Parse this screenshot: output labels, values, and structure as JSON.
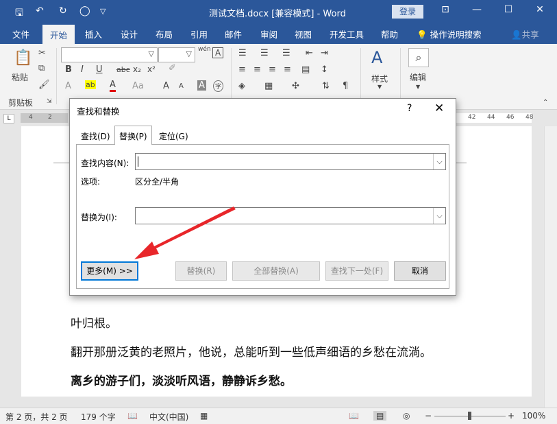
{
  "titlebar": {
    "doc_title": "测试文档.docx [兼容模式] - Word",
    "login_label": "登录",
    "qa_save": "🖫",
    "qa_undo": "↶",
    "qa_redo": "↻",
    "qa_circle": "◯",
    "qa_custom": "▽",
    "ribbon_display": "⊡",
    "minimize": "—",
    "maximize": "☐",
    "close": "✕"
  },
  "ribbon_tabs": [
    "文件",
    "开始",
    "插入",
    "设计",
    "布局",
    "引用",
    "邮件",
    "审阅",
    "视图",
    "开发工具",
    "帮助"
  ],
  "ribbon_search": "操作说明搜索",
  "ribbon_share": "共享",
  "ribbon": {
    "paste_label": "粘贴",
    "clipboard_label": "剪贴板",
    "styles_label": "样式",
    "editing_label": "编辑",
    "wen_label": "wén",
    "font_buttons": [
      "B",
      "I",
      "U",
      "abc",
      "x₂",
      "x²"
    ],
    "font_row3": [
      "A",
      "ab",
      "A",
      "Aa",
      "A",
      "A",
      "A",
      "字"
    ]
  },
  "ruler": {
    "left_nums": [
      "4",
      "2"
    ],
    "right_nums": [
      "42",
      "44",
      "46",
      "48"
    ],
    "corner": "L"
  },
  "document": {
    "para1": "叶归根。",
    "para2": "翻开那册泛黄的老照片，他说，总能听到一些低声细语的乡愁在流淌。",
    "para3": "离乡的游子们，淡淡听风语，静静诉乡愁。"
  },
  "dialog": {
    "title": "查找和替换",
    "help": "?",
    "close": "✕",
    "tabs": [
      "查找(D)",
      "替换(P)",
      "定位(G)"
    ],
    "find_label": "查找内容(N):",
    "find_value": "",
    "options_label": "选项:",
    "options_value": "区分全/半角",
    "replace_label": "替换为(I):",
    "replace_value": "",
    "more_button": "更多(M) >>",
    "replace_button": "替换(R)",
    "replace_all_button": "全部替换(A)",
    "find_next_button": "查找下一处(F)",
    "cancel_button": "取消"
  },
  "statusbar": {
    "page": "第 2 页，共 2 页",
    "words": "179 个字",
    "language": "中文(中国)",
    "zoom": "100%",
    "zoom_percent": 100
  },
  "colors": {
    "accent": "#2b579a",
    "arrow": "#e8262a"
  }
}
